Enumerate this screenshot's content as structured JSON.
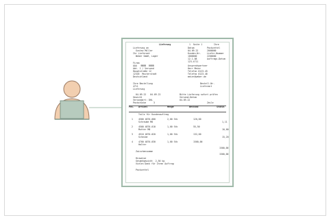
{
  "document": {
    "top": {
      "c1": "Lieferung",
      "c2": "1  Seite 1",
      "c3": "Ihre"
    },
    "sender": [
      "Lieferung an",
      "Gustav Müller",
      "Ihr Lieferant",
      "Weber GmbH, Lager"
    ],
    "meta_left": [
      "Datum",
      "04.09.22",
      "Kunden-Nr.",
      "1000000",
      "12.1.08",
      "123-4711"
    ],
    "meta_right": [
      "Packzettel",
      "2000000",
      "Liefer-Nummer",
      "2200000",
      "Auftrags-Datum"
    ],
    "address": [
      "Firma",
      "AAA   BBBB  BBBB",
      "Abt. 1 / Versand",
      "Hauptstraße 12",
      "12345  Musterstadt",
      "Deutschland"
    ],
    "contact": [
      "Ansprechpartner",
      "Herr Meier",
      "Telefon 0123-45",
      "Telefax 0123-46",
      "meier@weber.de"
    ],
    "ref_left": [
      "Ihre Bestellung",
      "4711",
      "Lieferung"
    ],
    "ref_right": [
      "Bestell-Nr.",
      "Lieferant"
    ],
    "shipping": [
      "04.09.22   04.09.22",
      "Gewicht",
      "Versandart: DHL",
      "Packstücke",
      "3"
    ],
    "shipping_right": [
      "Bitte Lieferung sofort prüfen",
      "Versand-Datum",
      "04.09.22",
      "Zeile"
    ],
    "table": {
      "headers": [
        "Pos.",
        "Artikel",
        "Menge",
        "Bestand",
        "Status"
      ],
      "group": "Teile für Kundenauftrag",
      "rows": [
        {
          "pos": "1",
          "article": "4500 4870-000",
          "desc": "Schraube M8",
          "qty": "2,00 Stk",
          "price": "120,00",
          "note": "",
          "val": "1,11"
        },
        {
          "pos": "2",
          "article": "4500 4870-010",
          "desc": "Mutter M8",
          "qty": "1,00 Stk",
          "price": "55,50",
          "note": "",
          "val": "10,00"
        },
        {
          "pos": "3",
          "article": "4510 4870-020",
          "desc": "Scheibe",
          "qty": "1,00 Stk",
          "price": "132,00",
          "note": "",
          "val": "15,20"
        },
        {
          "pos": "4",
          "article": "4700 4870-030",
          "desc": "Halter",
          "qty": "1,00 Stk",
          "price": "1500,00",
          "note": "",
          "val": ""
        }
      ],
      "subtotal_label": "Zwischensumme",
      "subtotal_values": [
        "1500,00",
        "1500,00"
      ]
    },
    "footer": [
      "Hinweise",
      "Gesamtgewicht  2,50 kg",
      "Vielen Dank für Ihren Auftrag"
    ],
    "footer_note": "Packzettel"
  },
  "colors": {
    "doc_border": "#9fb9a9",
    "connector": "#a8c0b0",
    "person_skin": "#f2cfb0",
    "person_body": "#f2cfb0",
    "laptop": "#b7cbbe"
  },
  "icons": {
    "person": "person-at-laptop-icon"
  }
}
